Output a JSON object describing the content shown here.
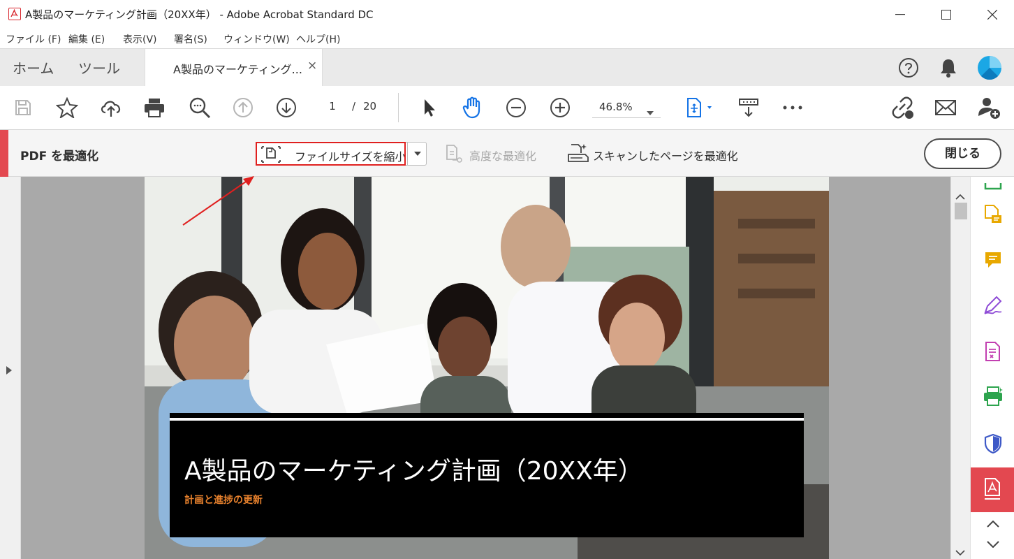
{
  "window": {
    "title": "A製品のマーケティング計画（20XX年） - Adobe Acrobat Standard DC",
    "icon": "acrobat-app-icon",
    "controls": [
      "minimize-icon",
      "maximize-icon",
      "close-icon"
    ]
  },
  "menubar": {
    "items": [
      "ファイル (F)",
      "編集 (E)",
      "表示(V)",
      "署名(S)",
      "ウィンドウ(W)",
      "ヘルプ(H)"
    ]
  },
  "tabs": {
    "home": "ホーム",
    "tools": "ツール",
    "document": "A製品のマーケティング...",
    "close": "×"
  },
  "header_icons": [
    "help-icon",
    "bell-icon",
    "avatar"
  ],
  "toolbar": {
    "page_current": "1",
    "page_separator": "/",
    "page_total": "20",
    "zoom": "46.8%",
    "icons": [
      "save-icon",
      "star-icon",
      "cloud-upload-icon",
      "print-icon",
      "search-icon",
      "arrow-up-circle-icon",
      "arrow-down-circle-icon",
      "pointer-icon",
      "hand-icon",
      "zoom-out-icon",
      "zoom-in-icon",
      "fit-page-icon",
      "scroll-mode-icon",
      "more-icon",
      "link-icon",
      "mail-icon",
      "add-user-icon"
    ]
  },
  "optimize": {
    "title": "PDF を最適化",
    "reduce_label": "ファイルサイズを縮小",
    "advanced_label": "高度な最適化",
    "scan_label": "スキャンしたページを最適化",
    "close_label": "閉じる"
  },
  "document": {
    "heading": "A製品のマーケティング計画（20XX年）",
    "subheading": "計画と進捗の更新"
  },
  "colors": {
    "accent": "#e34850",
    "highlight": "#e0201f",
    "active_blue": "#1473e6",
    "subheading": "#e9822d"
  }
}
